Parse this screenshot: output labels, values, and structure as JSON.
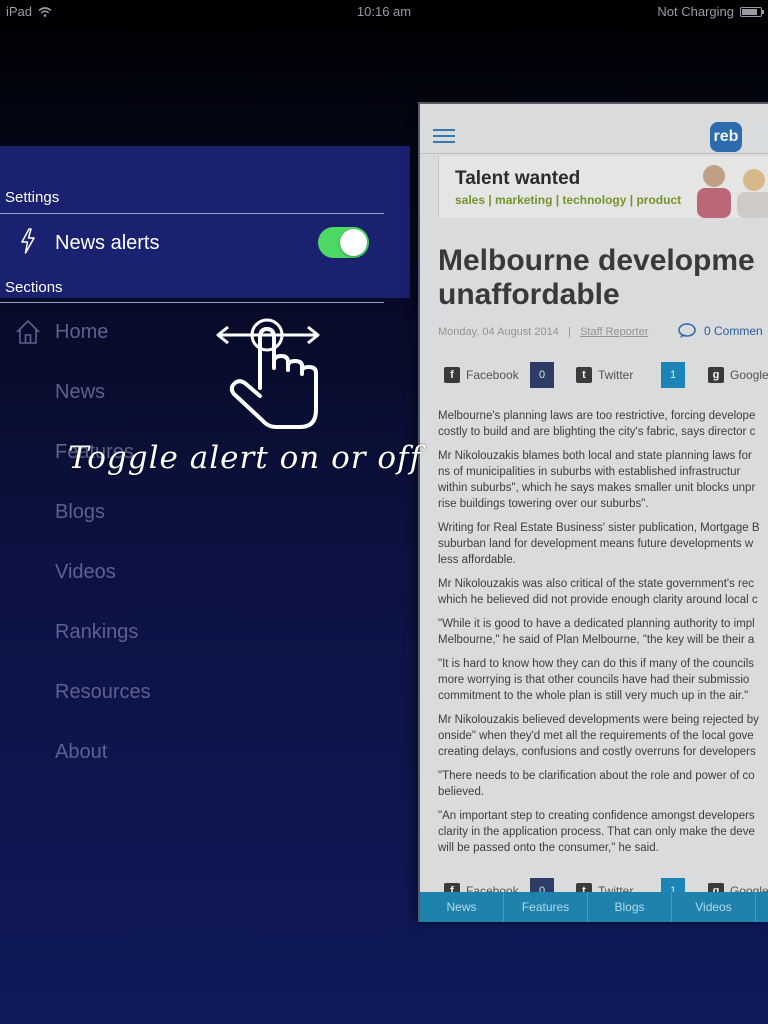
{
  "status_bar": {
    "device": "iPad",
    "time": "10:16 am",
    "battery_status": "Not Charging"
  },
  "menu": {
    "settings_label": "Settings",
    "news_alerts_label": "News alerts",
    "news_alerts_on": true,
    "sections_label": "Sections",
    "items": [
      {
        "label": "Home",
        "icon": "home-icon"
      },
      {
        "label": "News"
      },
      {
        "label": "Features"
      },
      {
        "label": "Blogs"
      },
      {
        "label": "Videos"
      },
      {
        "label": "Rankings"
      },
      {
        "label": "Resources"
      },
      {
        "label": "About"
      }
    ]
  },
  "hint": {
    "text": "Toggle alert on or off"
  },
  "article": {
    "logo": "reb",
    "banner_headline": "Talent wanted",
    "banner_sub": "sales | marketing | technology | product",
    "title_line1": "Melbourne developme",
    "title_line2": "unaffordable",
    "date": "Monday, 04 August 2014",
    "separator": "|",
    "author": "Staff Reporter",
    "comments": "0 Commen",
    "share_top": {
      "facebook": "Facebook",
      "facebook_count": "0",
      "twitter": "Twitter",
      "twitter_count": "1",
      "google": "Google"
    },
    "share_bottom": {
      "facebook": "Facebook",
      "facebook_count": "0",
      "twitter": "Twitter",
      "twitter_count": "1",
      "google": "Google"
    },
    "paragraphs": [
      [
        "Melbourne's planning laws are too restrictive, forcing develope",
        "costly to build and are blighting the city's fabric, says director c"
      ],
      [
        "Mr Nikolouzakis blames both local and state planning laws for",
        "ns of municipalities in suburbs with established infrastructur",
        "within suburbs\", which he says makes smaller unit blocks unpr",
        "rise buildings towering over our suburbs\"."
      ],
      [
        "Writing for Real Estate Business' sister publication, Mortgage B",
        "suburban land for development means future developments w",
        "less affordable."
      ],
      [
        "Mr Nikolouzakis was also critical of the state government's rec",
        "which he believed did not provide enough clarity around local c"
      ],
      [
        "\"While it is good to have a dedicated planning authority to impl",
        "Melbourne,\" he said of Plan Melbourne, \"the key will be their a"
      ],
      [
        "\"It is hard to know how they can do this if many of the councils",
        "more worrying is that other councils have had their submissio",
        "commitment to the whole plan is still very much up in the air.\""
      ],
      [
        "Mr Nikolouzakis believed developments were being rejected by",
        "onside\" when they'd met all the requirements of the local gove",
        "creating delays, confusions and costly overruns for developers"
      ],
      [
        "\"There needs to be clarification about the role and power of co",
        "believed."
      ],
      [
        "\"An important step to creating confidence amongst developers",
        "clarity in the application process. That can only make the deve",
        "will be passed onto the consumer,\" he said."
      ]
    ],
    "bottom_tabs": [
      "News",
      "Features",
      "Blogs",
      "Videos"
    ]
  }
}
